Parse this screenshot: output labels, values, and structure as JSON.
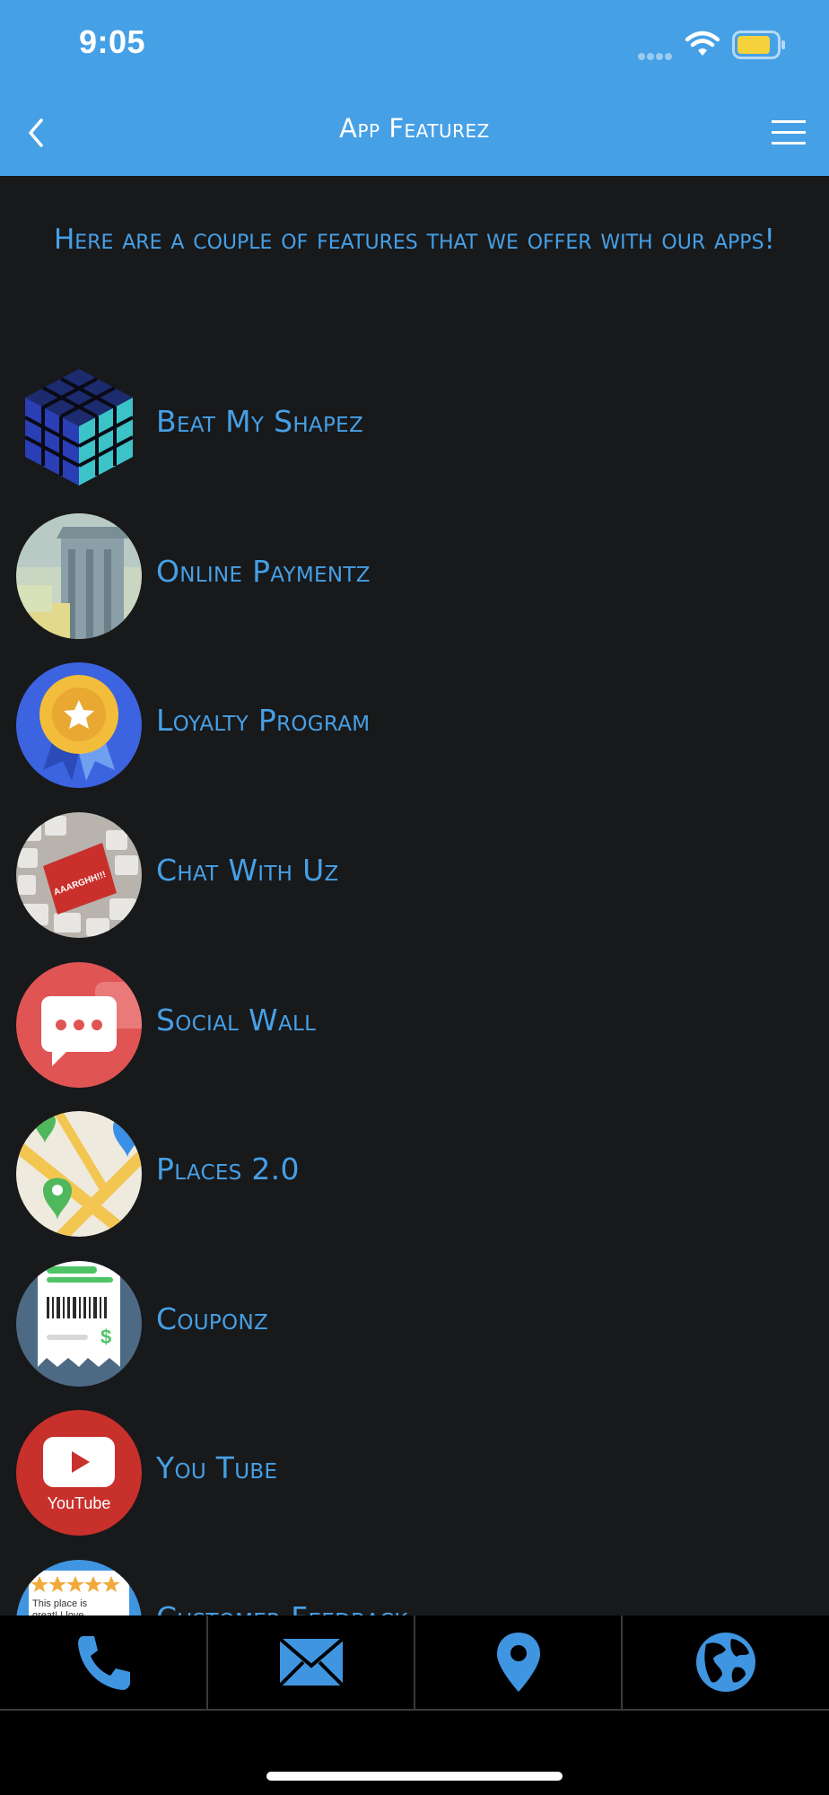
{
  "status_bar": {
    "time": "9:05",
    "accent_battery": "#f5d23c"
  },
  "nav": {
    "title": "App Featurez"
  },
  "intro_text": "Here are a couple of features that we offer with our apps!",
  "features": [
    {
      "label": "Beat My Shapez",
      "icon": "cube-puzzle-icon"
    },
    {
      "label": "Online Paymentz",
      "icon": "banknote-icon"
    },
    {
      "label": "Loyalty Program",
      "icon": "award-badge-icon"
    },
    {
      "label": "Chat With Uz",
      "icon": "keyboard-icon"
    },
    {
      "label": "Social Wall",
      "icon": "chat-bubble-icon"
    },
    {
      "label": "Places 2.0",
      "icon": "map-pin-icon"
    },
    {
      "label": "Couponz",
      "icon": "receipt-icon"
    },
    {
      "label": "You Tube",
      "icon": "youtube-icon",
      "thumb_text": "YouTube"
    },
    {
      "label": "Customer Feedback",
      "icon": "review-stars-icon",
      "thumb_text": "This place is great! I love coming here :)"
    }
  ],
  "tab_bar": [
    {
      "name": "phone-icon"
    },
    {
      "name": "mail-icon"
    },
    {
      "name": "location-pin-icon"
    },
    {
      "name": "globe-icon"
    }
  ],
  "colors": {
    "accent": "#46a0e6",
    "background": "#18191b",
    "tab_bar": "#000000"
  }
}
